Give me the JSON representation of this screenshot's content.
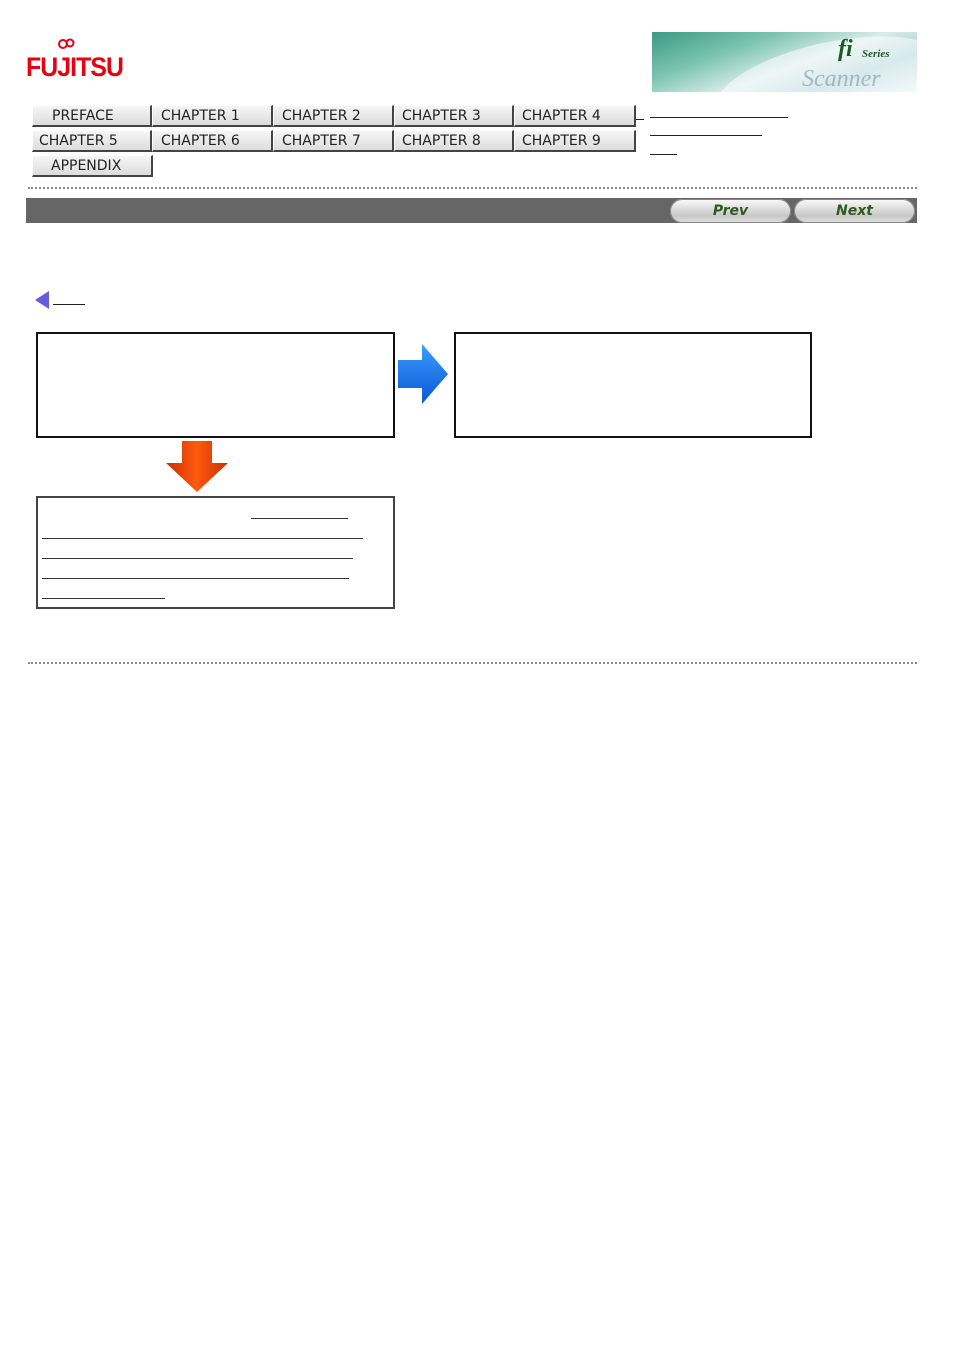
{
  "header": {
    "logo_text": "FUJITSU",
    "banner": {
      "fi": "fi",
      "series": "Series",
      "scanner": "Scanner"
    }
  },
  "nav": {
    "buttons": [
      {
        "label": "PREFACE"
      },
      {
        "label": "CHAPTER 1"
      },
      {
        "label": "CHAPTER 2"
      },
      {
        "label": "CHAPTER 3"
      },
      {
        "label": "CHAPTER 4"
      },
      {
        "label": "CHAPTER 5"
      },
      {
        "label": "CHAPTER 6"
      },
      {
        "label": "CHAPTER 7"
      },
      {
        "label": "CHAPTER 8"
      },
      {
        "label": "CHAPTER 9"
      },
      {
        "label": "APPENDIX"
      }
    ]
  },
  "pager": {
    "prev_label": "Prev",
    "next_label": "Next"
  },
  "colors": {
    "logo_red": "#e60012",
    "bar_gray": "#666666",
    "right_arrow_blue": "#1a73e8",
    "down_arrow_orange": "#ff4d00",
    "back_arrow_purple": "#6b5ae0",
    "pager_text_green": "#2f5a1f"
  }
}
